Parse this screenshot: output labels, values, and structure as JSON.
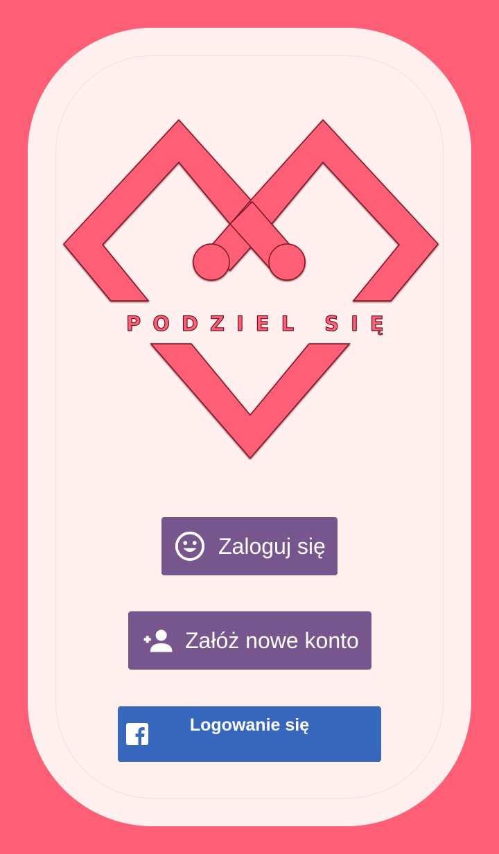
{
  "app": {
    "logo_text": "PODZIEL SIĘ",
    "colors": {
      "background": "#fe5f77",
      "card": "#fff0ef",
      "primary_button": "#77568d",
      "facebook_button": "#3767bd",
      "text_on_button": "#ffffff"
    }
  },
  "buttons": {
    "login": {
      "label": "Zaloguj się",
      "icon": "smiley-face-icon"
    },
    "register": {
      "label": "Załóż nowe konto",
      "icon": "add-person-icon"
    },
    "facebook": {
      "label": "Logowanie się",
      "icon": "facebook-icon"
    }
  }
}
